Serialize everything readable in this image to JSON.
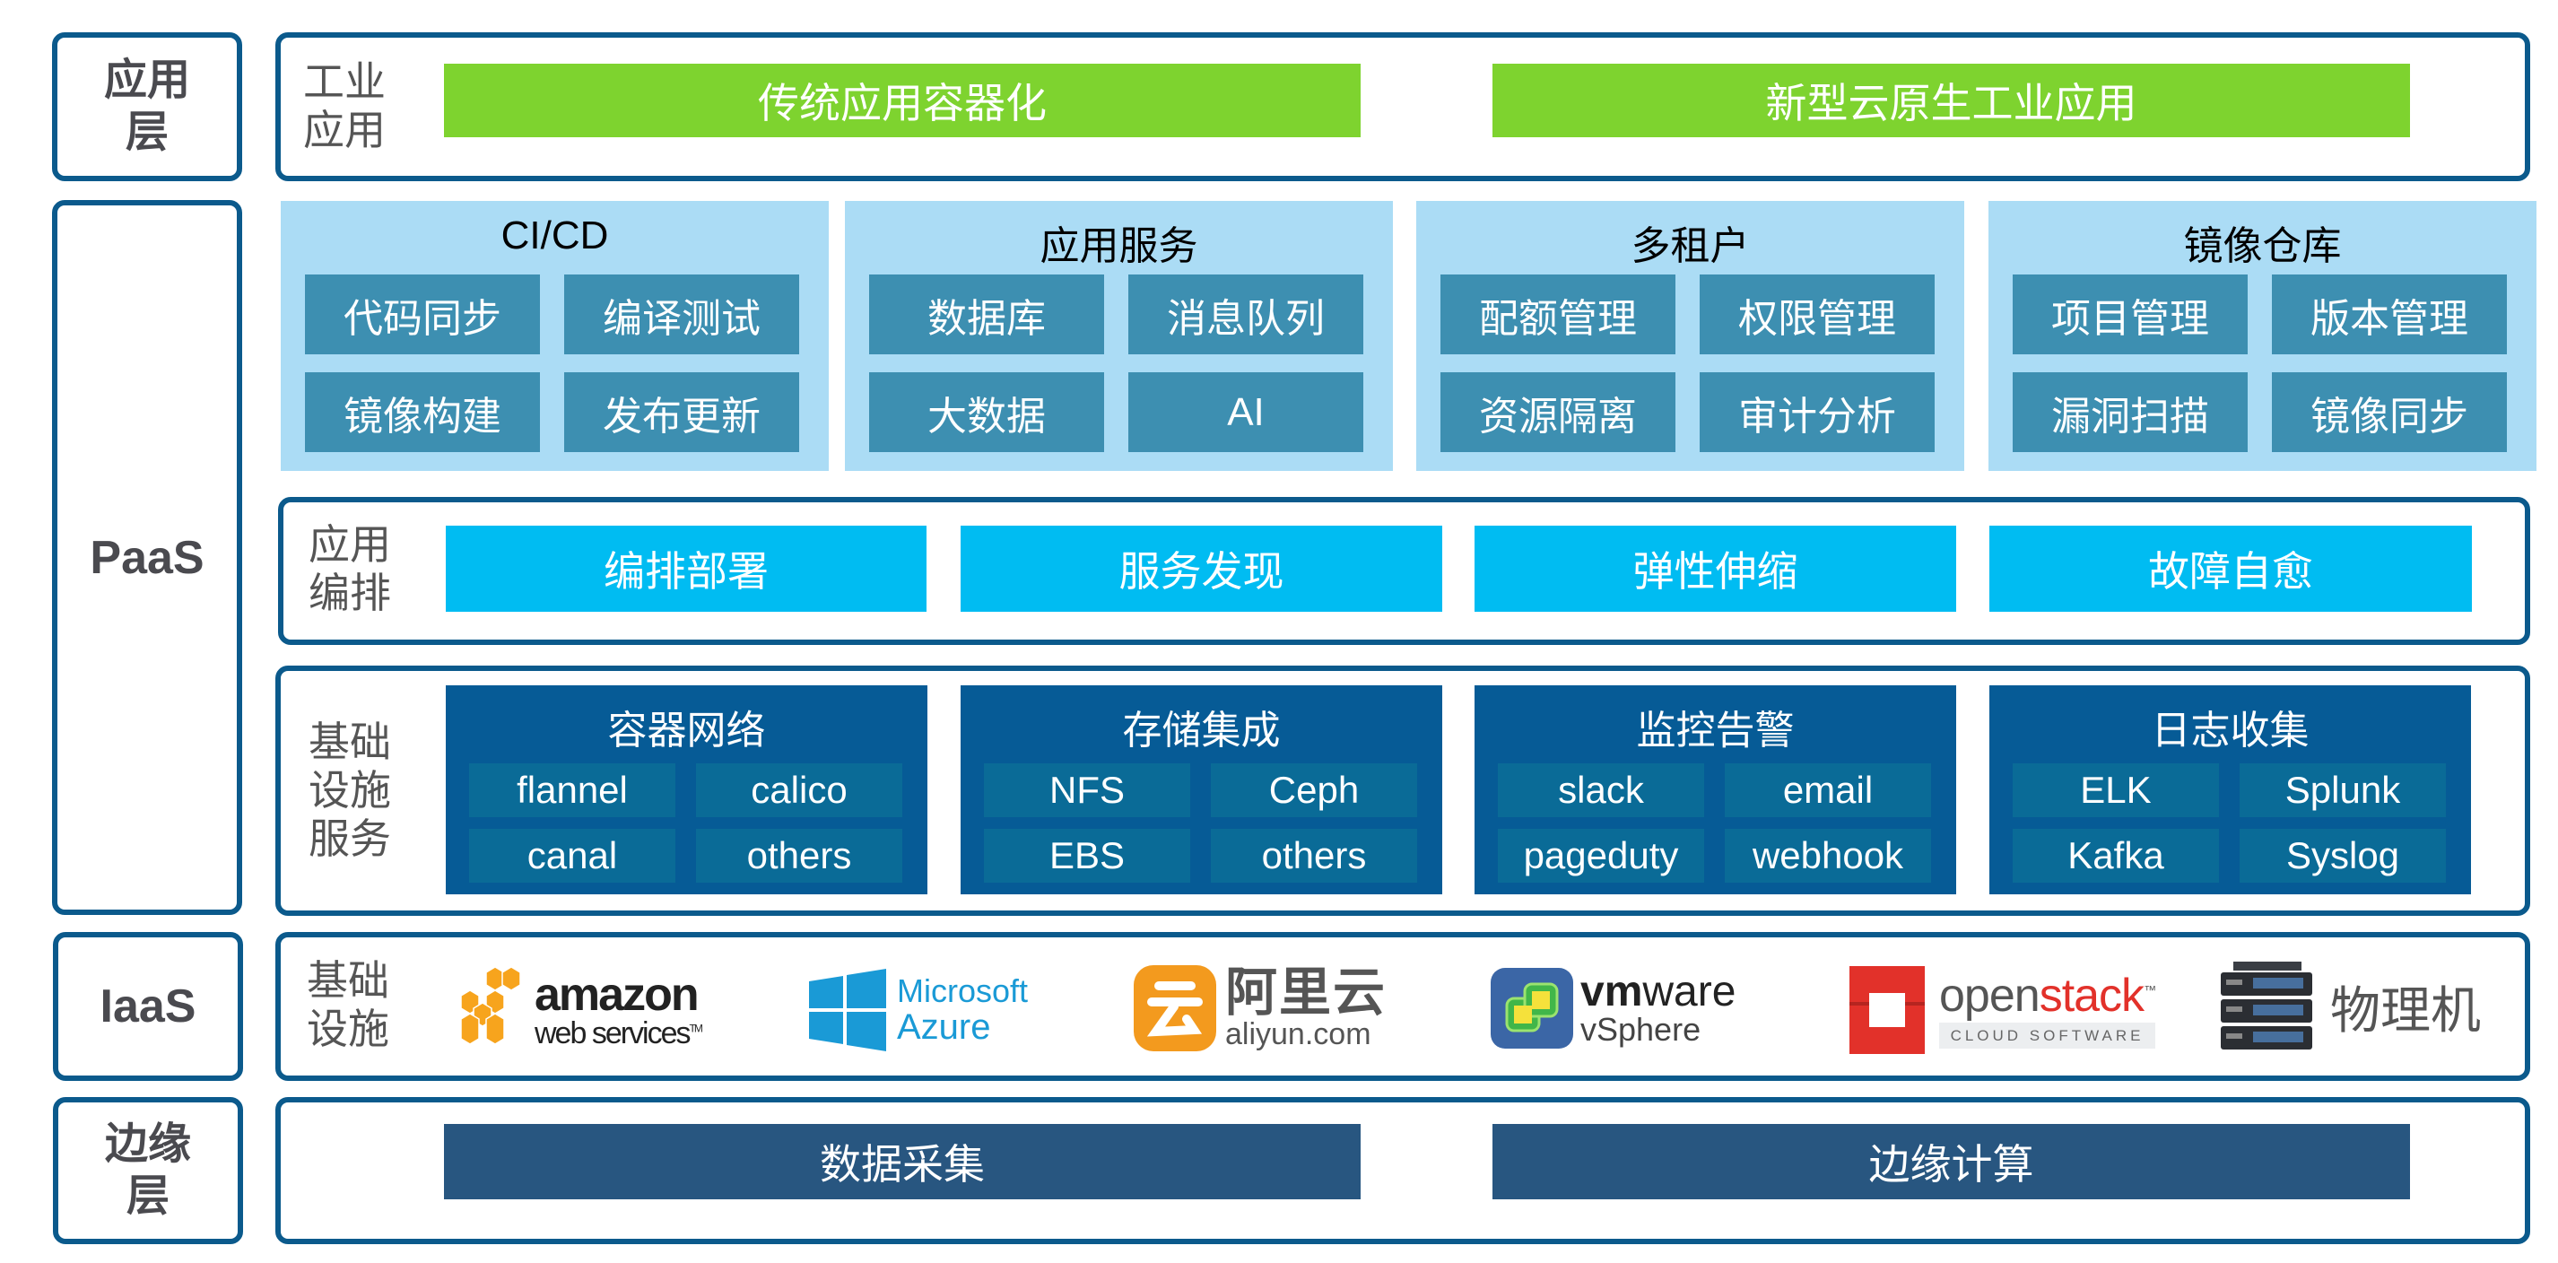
{
  "layers": {
    "app": {
      "label_lines": [
        "应用",
        "层"
      ],
      "side_label_lines": [
        "工业",
        "应用"
      ],
      "bars": [
        "传统应用容器化",
        "新型云原生工业应用"
      ]
    },
    "paas": {
      "label": "PaaS",
      "panels": [
        {
          "title": "CI/CD",
          "items": [
            "代码同步",
            "编译测试",
            "镜像构建",
            "发布更新"
          ]
        },
        {
          "title": "应用服务",
          "items": [
            "数据库",
            "消息队列",
            "大数据",
            "AI"
          ]
        },
        {
          "title": "多租户",
          "items": [
            "配额管理",
            "权限管理",
            "资源隔离",
            "审计分析"
          ]
        },
        {
          "title": "镜像仓库",
          "items": [
            "项目管理",
            "版本管理",
            "漏洞扫描",
            "镜像同步"
          ]
        }
      ],
      "orchestration": {
        "side_label_lines": [
          "应用",
          "编排"
        ],
        "bars": [
          "编排部署",
          "服务发现",
          "弹性伸缩",
          "故障自愈"
        ]
      },
      "infra_services": {
        "side_label_lines": [
          "基础",
          "设施",
          "服务"
        ],
        "panels": [
          {
            "title": "容器网络",
            "items": [
              "flannel",
              "calico",
              "canal",
              "others"
            ]
          },
          {
            "title": "存储集成",
            "items": [
              "NFS",
              "Ceph",
              "EBS",
              "others"
            ]
          },
          {
            "title": "监控告警",
            "items": [
              "slack",
              "email",
              "pageduty",
              "webhook"
            ]
          },
          {
            "title": "日志收集",
            "items": [
              "ELK",
              "Splunk",
              "Kafka",
              "Syslog"
            ]
          }
        ]
      }
    },
    "iaas": {
      "label": "IaaS",
      "side_label_lines": [
        "基础",
        "设施"
      ],
      "providers": {
        "aws": {
          "line1": "amazon",
          "line2": "web services",
          "tm": "TM"
        },
        "azure": {
          "line1": "Microsoft",
          "line2": "Azure"
        },
        "aliyun": {
          "cn": "阿里云",
          "domain": "aliyun.com"
        },
        "vmware": {
          "line1_bold": "vm",
          "line1_rest": "ware",
          "line2": "vSphere"
        },
        "openstack": {
          "open": "open",
          "stack": "stack",
          "tm": "™",
          "sub": "CLOUD SOFTWARE"
        },
        "physical": {
          "label": "物理机"
        }
      }
    },
    "edge": {
      "label_lines": [
        "边缘",
        "层"
      ],
      "bars": [
        "数据采集",
        "边缘计算"
      ]
    }
  },
  "colors": {
    "border": "#0b5a8c",
    "green": "#7ed32f",
    "cyan": "#00bcf2",
    "light_panel": "#abdcf5",
    "tile": "#3d8fb1",
    "dark_panel": "#065b96",
    "sub_tile": "#0a6b97",
    "edge_bar": "#285680"
  }
}
